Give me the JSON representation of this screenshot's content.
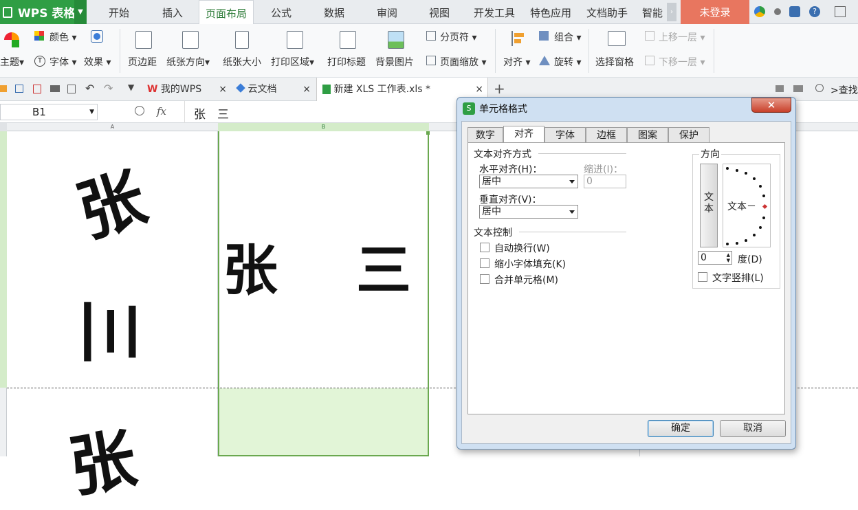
{
  "app": {
    "name": "WPS 表格"
  },
  "menu_tabs": [
    "开始",
    "插入",
    "页面布局",
    "公式",
    "数据",
    "审阅",
    "视图",
    "开发工具",
    "特色应用",
    "文档助手",
    "智能"
  ],
  "login_label": "未登录",
  "ribbon": {
    "theme": "主题",
    "color": "颜色",
    "font": "字体",
    "effect": "效果",
    "margin": "页边距",
    "orientation": "纸张方向",
    "size": "纸张大小",
    "print_area": "打印区域",
    "print_titles": "打印标题",
    "background": "背景图片",
    "page_break": "分页符",
    "page_zoom": "页面缩放",
    "align": "对齐",
    "group": "组合",
    "rotate": "旋转",
    "selection_pane": "选择窗格",
    "bring_forward": "上移一层",
    "send_backward": "下移一层"
  },
  "doc_tabs": [
    "我的WPS",
    "云文档",
    "新建 XLS 工作表.xls *"
  ],
  "search_label": ">查找",
  "formula_bar": {
    "name_box": "B1",
    "fx": "fx",
    "content": "张　三"
  },
  "columns": [
    "A",
    "B"
  ],
  "cells": {
    "a_chars": [
      "张",
      "三",
      "张"
    ],
    "b1_chars": [
      "张",
      "三"
    ]
  },
  "dialog": {
    "title": "单元格格式",
    "tabs": [
      "数字",
      "对齐",
      "字体",
      "边框",
      "图案",
      "保护"
    ],
    "active_tab": "对齐",
    "text_align_group": "文本对齐方式",
    "horizontal_label": "水平对齐(H)：",
    "horizontal_value": "居中",
    "indent_label": "缩进(I)：",
    "indent_value": "0",
    "vertical_label": "垂直对齐(V)：",
    "vertical_value": "居中",
    "text_control_group": "文本控制",
    "wrap_text": "自动换行(W)",
    "shrink_to_fit": "缩小字体填充(K)",
    "merge_cells": "合并单元格(M)",
    "orientation_group": "方向",
    "vertical_text_chars": [
      "文",
      "本"
    ],
    "dial_text": "文本－",
    "degree_value": "0",
    "degree_label": "度(D)",
    "vertical_stack": "文字竖排(L)",
    "ok": "确定",
    "cancel": "取消"
  },
  "colors": {
    "accent": "#2f9e44",
    "login": "#e8765f",
    "selected_cell": "#e2f5d7"
  }
}
